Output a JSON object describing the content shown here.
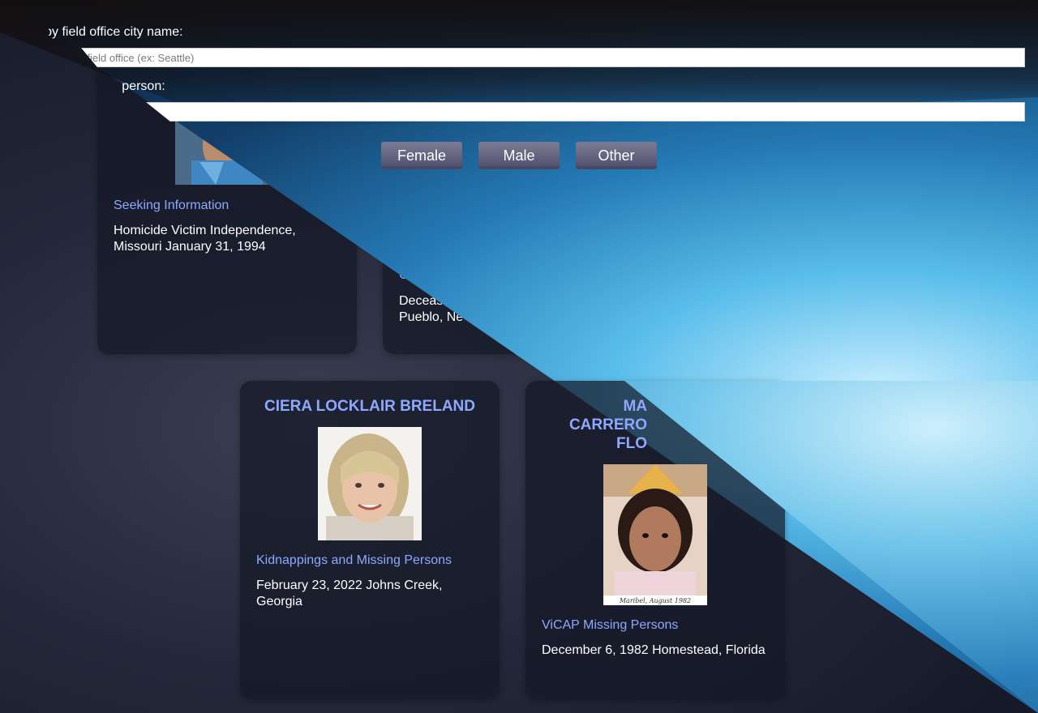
{
  "search": {
    "city_label": "Search by field office city name:",
    "city_placeholder": "Enter the field office (ex: Seattle)",
    "name_label": "Search most wanted person:",
    "name_placeholder": ""
  },
  "filters": {
    "female": "Female",
    "male": "Male",
    "other": "Other"
  },
  "cards": [
    {
      "title": "",
      "category": "Seeking Information",
      "description": "Homicide Victim Independence, Missouri January 31, 1994"
    },
    {
      "title": "",
      "category": "C",
      "description": "Deceas Pueblo, Ne"
    },
    {
      "title": "CIERA LOCKLAIR BRELAND",
      "category": "Kidnappings and Missing Persons",
      "description": "February 23, 2022 Johns Creek, Georgia"
    },
    {
      "title": "MA CARRERO FLO",
      "category": "ViCAP Missing Persons",
      "description": "December 6, 1982 Homestead, Florida",
      "photo_caption": "Maribel, August 1982"
    }
  ],
  "colors": {
    "accent": "#8fa8ff",
    "button": "#5c5c7a"
  }
}
